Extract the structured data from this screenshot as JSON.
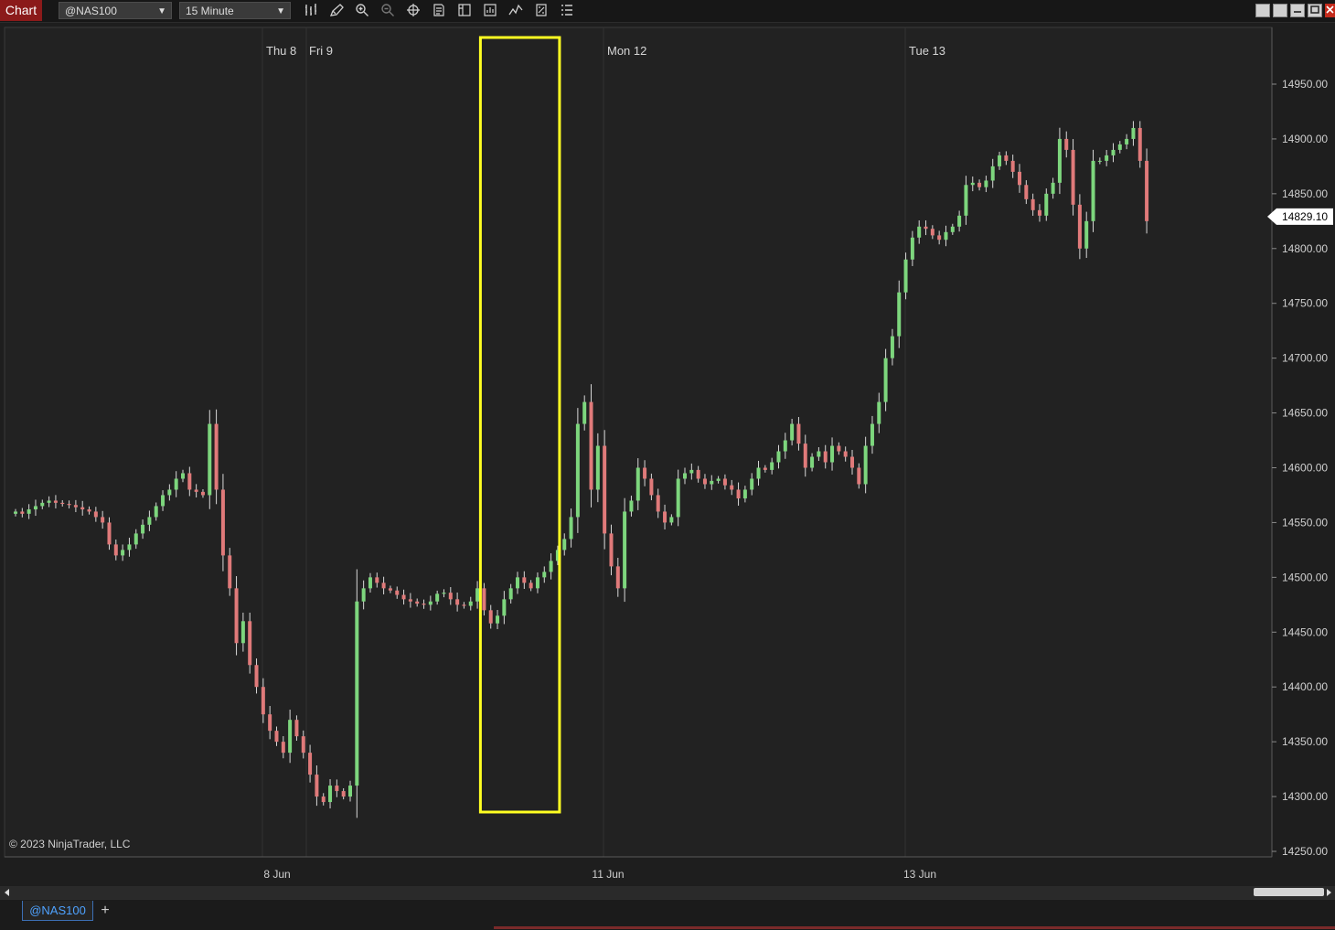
{
  "toolbar": {
    "chart_tab_label": "Chart",
    "instrument": "@NAS100",
    "interval": "15 Minute",
    "tools": [
      "bars-type-icon",
      "pencil-draw-icon",
      "zoom-in-icon",
      "zoom-out-icon",
      "crosshair-icon",
      "data-box-icon",
      "properties-icon",
      "strategies-icon",
      "indicators-icon",
      "templates-icon",
      "list-menu-icon"
    ],
    "window_buttons": [
      "minimize-icon",
      "restore-icon",
      "maximize-icon",
      "close-icon"
    ]
  },
  "tabs": {
    "instrument_tab": "@NAS100",
    "add_tab_symbol": "+"
  },
  "chart": {
    "copyright": "© 2023 NinjaTrader, LLC",
    "last_price": "14829.10",
    "colors": {
      "up": "#7dd67d",
      "down": "#e07a7a",
      "wick": "#d8d8d8",
      "highlight": "#ffff22",
      "background": "#222222",
      "price_tag": "#ffffff"
    }
  },
  "chart_data": {
    "type": "candlestick",
    "symbol": "@NAS100",
    "interval": "15 Minute",
    "day_labels": [
      "Thu 8",
      "Fri 9",
      "Mon 12",
      "Tue 13"
    ],
    "x_tick_labels": [
      "8 Jun",
      "11 Jun",
      "13 Jun"
    ],
    "y_ticks": [
      14250,
      14300,
      14350,
      14400,
      14450,
      14500,
      14550,
      14600,
      14650,
      14700,
      14750,
      14800,
      14850,
      14900,
      14950
    ],
    "y_tick_labels": [
      "14250.00",
      "14300.00",
      "14350.00",
      "14400.00",
      "14450.00",
      "14500.00",
      "14550.00",
      "14600.00",
      "14650.00",
      "14700.00",
      "14750.00",
      "14800.00",
      "14850.00",
      "14900.00",
      "14950.00"
    ],
    "ylim": [
      14245,
      14980
    ],
    "last_price": 14829.1,
    "highlight": {
      "from_bar": 70,
      "to_bar": 81,
      "price_high": 14975,
      "price_low": 14285
    },
    "closes": [
      14560,
      14558,
      14562,
      14565,
      14568,
      14570,
      14568,
      14567,
      14566,
      14564,
      14562,
      14560,
      14555,
      14550,
      14530,
      14520,
      14525,
      14530,
      14540,
      14548,
      14555,
      14565,
      14575,
      14580,
      14590,
      14595,
      14580,
      14578,
      14575,
      14640,
      14580,
      14520,
      14490,
      14440,
      14460,
      14420,
      14400,
      14375,
      14360,
      14350,
      14340,
      14370,
      14355,
      14340,
      14320,
      14300,
      14295,
      14310,
      14305,
      14300,
      14310,
      14478,
      14490,
      14500,
      14495,
      14490,
      14488,
      14484,
      14480,
      14478,
      14476,
      14475,
      14478,
      14485,
      14486,
      14480,
      14475,
      14474,
      14478,
      14490,
      14470,
      14458,
      14465,
      14480,
      14490,
      14500,
      14495,
      14490,
      14500,
      14505,
      14515,
      14525,
      14535,
      14555,
      14640,
      14660,
      14580,
      14620,
      14540,
      14510,
      14490,
      14560,
      14570,
      14600,
      14590,
      14575,
      14560,
      14550,
      14555,
      14590,
      14595,
      14598,
      14590,
      14585,
      14588,
      14590,
      14584,
      14580,
      14572,
      14580,
      14590,
      14600,
      14598,
      14605,
      14615,
      14625,
      14640,
      14622,
      14600,
      14610,
      14615,
      14605,
      14620,
      14615,
      14610,
      14600,
      14585,
      14620,
      14640,
      14660,
      14700,
      14720,
      14760,
      14790,
      14810,
      14820,
      14818,
      14812,
      14808,
      14815,
      14820,
      14830,
      14858,
      14860,
      14856,
      14862,
      14875,
      14885,
      14880,
      14870,
      14858,
      14845,
      14835,
      14830,
      14850,
      14860,
      14900,
      14890,
      14840,
      14800,
      14825,
      14880,
      14880,
      14885,
      14890,
      14895,
      14900,
      14910,
      14880,
      14825
    ]
  }
}
